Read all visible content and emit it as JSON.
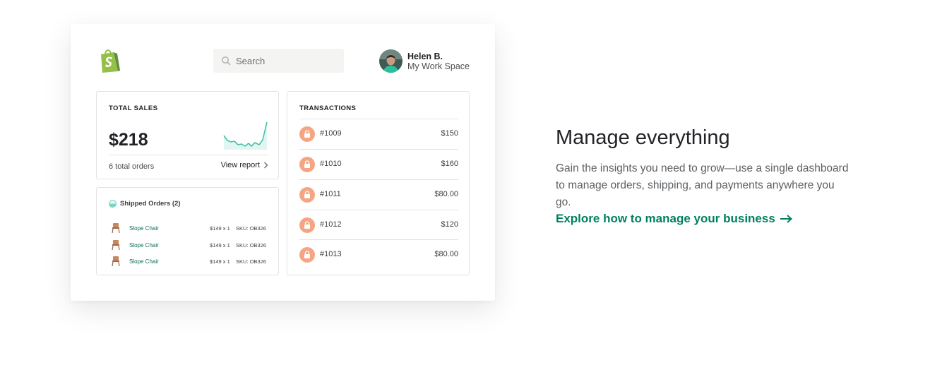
{
  "header": {
    "logo_icon": "shopify-bag-icon",
    "search": {
      "placeholder": "Search",
      "icon": "search-icon"
    },
    "user": {
      "name": "Helen B.",
      "workspace": "My Work Space"
    }
  },
  "total_sales": {
    "title": "TOTAL SALES",
    "amount": "$218",
    "orders": "6 total orders",
    "link": "View report"
  },
  "shipped_orders": {
    "title": "Shipped Orders (2)",
    "items": [
      {
        "name": "Slope Chair",
        "price": "$149 x 1",
        "sku": "SKU: OB326"
      },
      {
        "name": "Slope Chair",
        "price": "$149 x 1",
        "sku": "SKU: OB326"
      },
      {
        "name": "Slope Chair",
        "price": "$149 x 1",
        "sku": "SKU: OB326"
      }
    ]
  },
  "transactions": {
    "title": "TRANSACTIONS",
    "rows": [
      {
        "id": "#1009",
        "amount": "$150"
      },
      {
        "id": "#1010",
        "amount": "$160"
      },
      {
        "id": "#1011",
        "amount": "$80.00"
      },
      {
        "id": "#1012",
        "amount": "$120"
      },
      {
        "id": "#1013",
        "amount": "$80.00"
      }
    ]
  },
  "feature": {
    "heading": "Manage everything",
    "body": "Gain the insights you need to grow—use a single dashboard to manage orders, shipping, and payments anywhere you go.",
    "cta": "Explore how to manage your business"
  },
  "colors": {
    "brand_green": "#008060",
    "logo_green": "#95bf47",
    "lock_peach": "#f4a683",
    "spark_teal": "#47c1a8"
  }
}
